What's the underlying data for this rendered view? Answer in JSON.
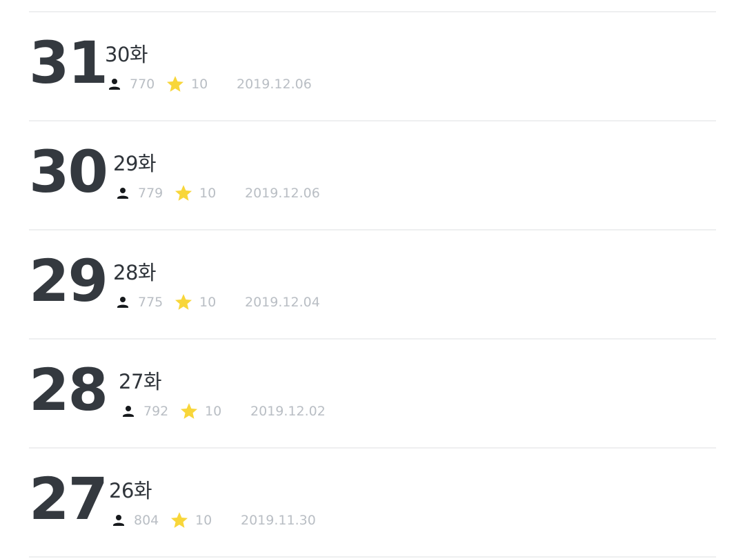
{
  "episodes": [
    {
      "number": "31",
      "title": "30화",
      "views": "770",
      "rating": "10",
      "date": "2019.12.06"
    },
    {
      "number": "30",
      "title": "29화",
      "views": "779",
      "rating": "10",
      "date": "2019.12.06"
    },
    {
      "number": "29",
      "title": "28화",
      "views": "775",
      "rating": "10",
      "date": "2019.12.04"
    },
    {
      "number": "28",
      "title": "27화",
      "views": "792",
      "rating": "10",
      "date": "2019.12.02"
    },
    {
      "number": "27",
      "title": "26화",
      "views": "804",
      "rating": "10",
      "date": "2019.11.30"
    }
  ],
  "icons": {
    "views": "person-icon",
    "rating": "star-icon"
  },
  "colors": {
    "number": "#34393f",
    "title": "#2f343a",
    "meta_text": "#b9bec4",
    "star": "#f8d63a",
    "divider": "#eeeff0"
  }
}
